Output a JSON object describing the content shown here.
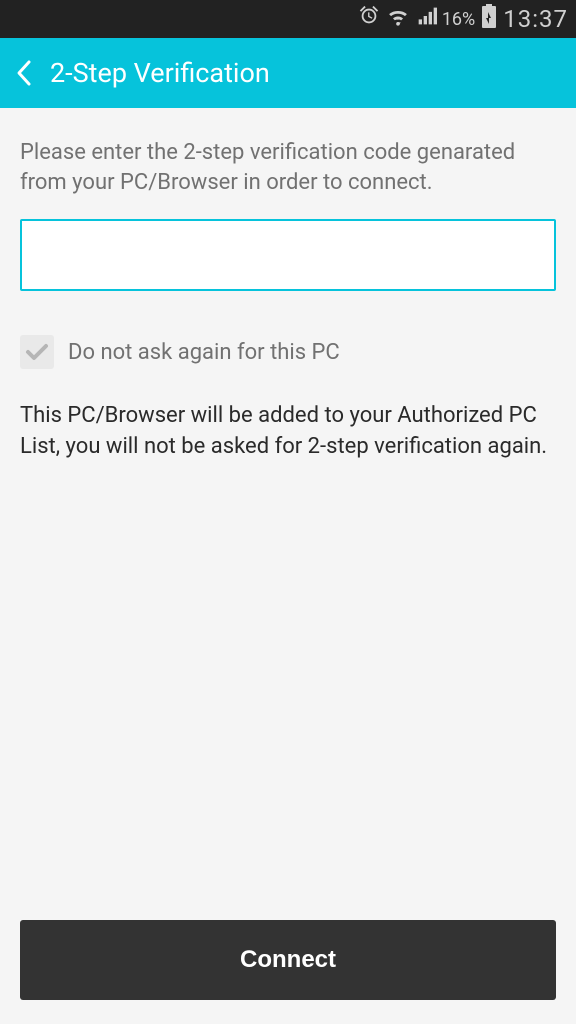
{
  "statusBar": {
    "batteryPercent": "16%",
    "time": "13:37"
  },
  "appBar": {
    "title": "2-Step Verification"
  },
  "content": {
    "instruction": "Please enter the 2-step verification code genarated from your PC/Browser in order to connect.",
    "codeValue": "",
    "checkboxLabel": "Do not ask again for this PC",
    "explanation": "This PC/Browser will be added to your Authorized PC List, you will not be asked for 2-step verification again."
  },
  "footer": {
    "connectLabel": "Connect"
  }
}
